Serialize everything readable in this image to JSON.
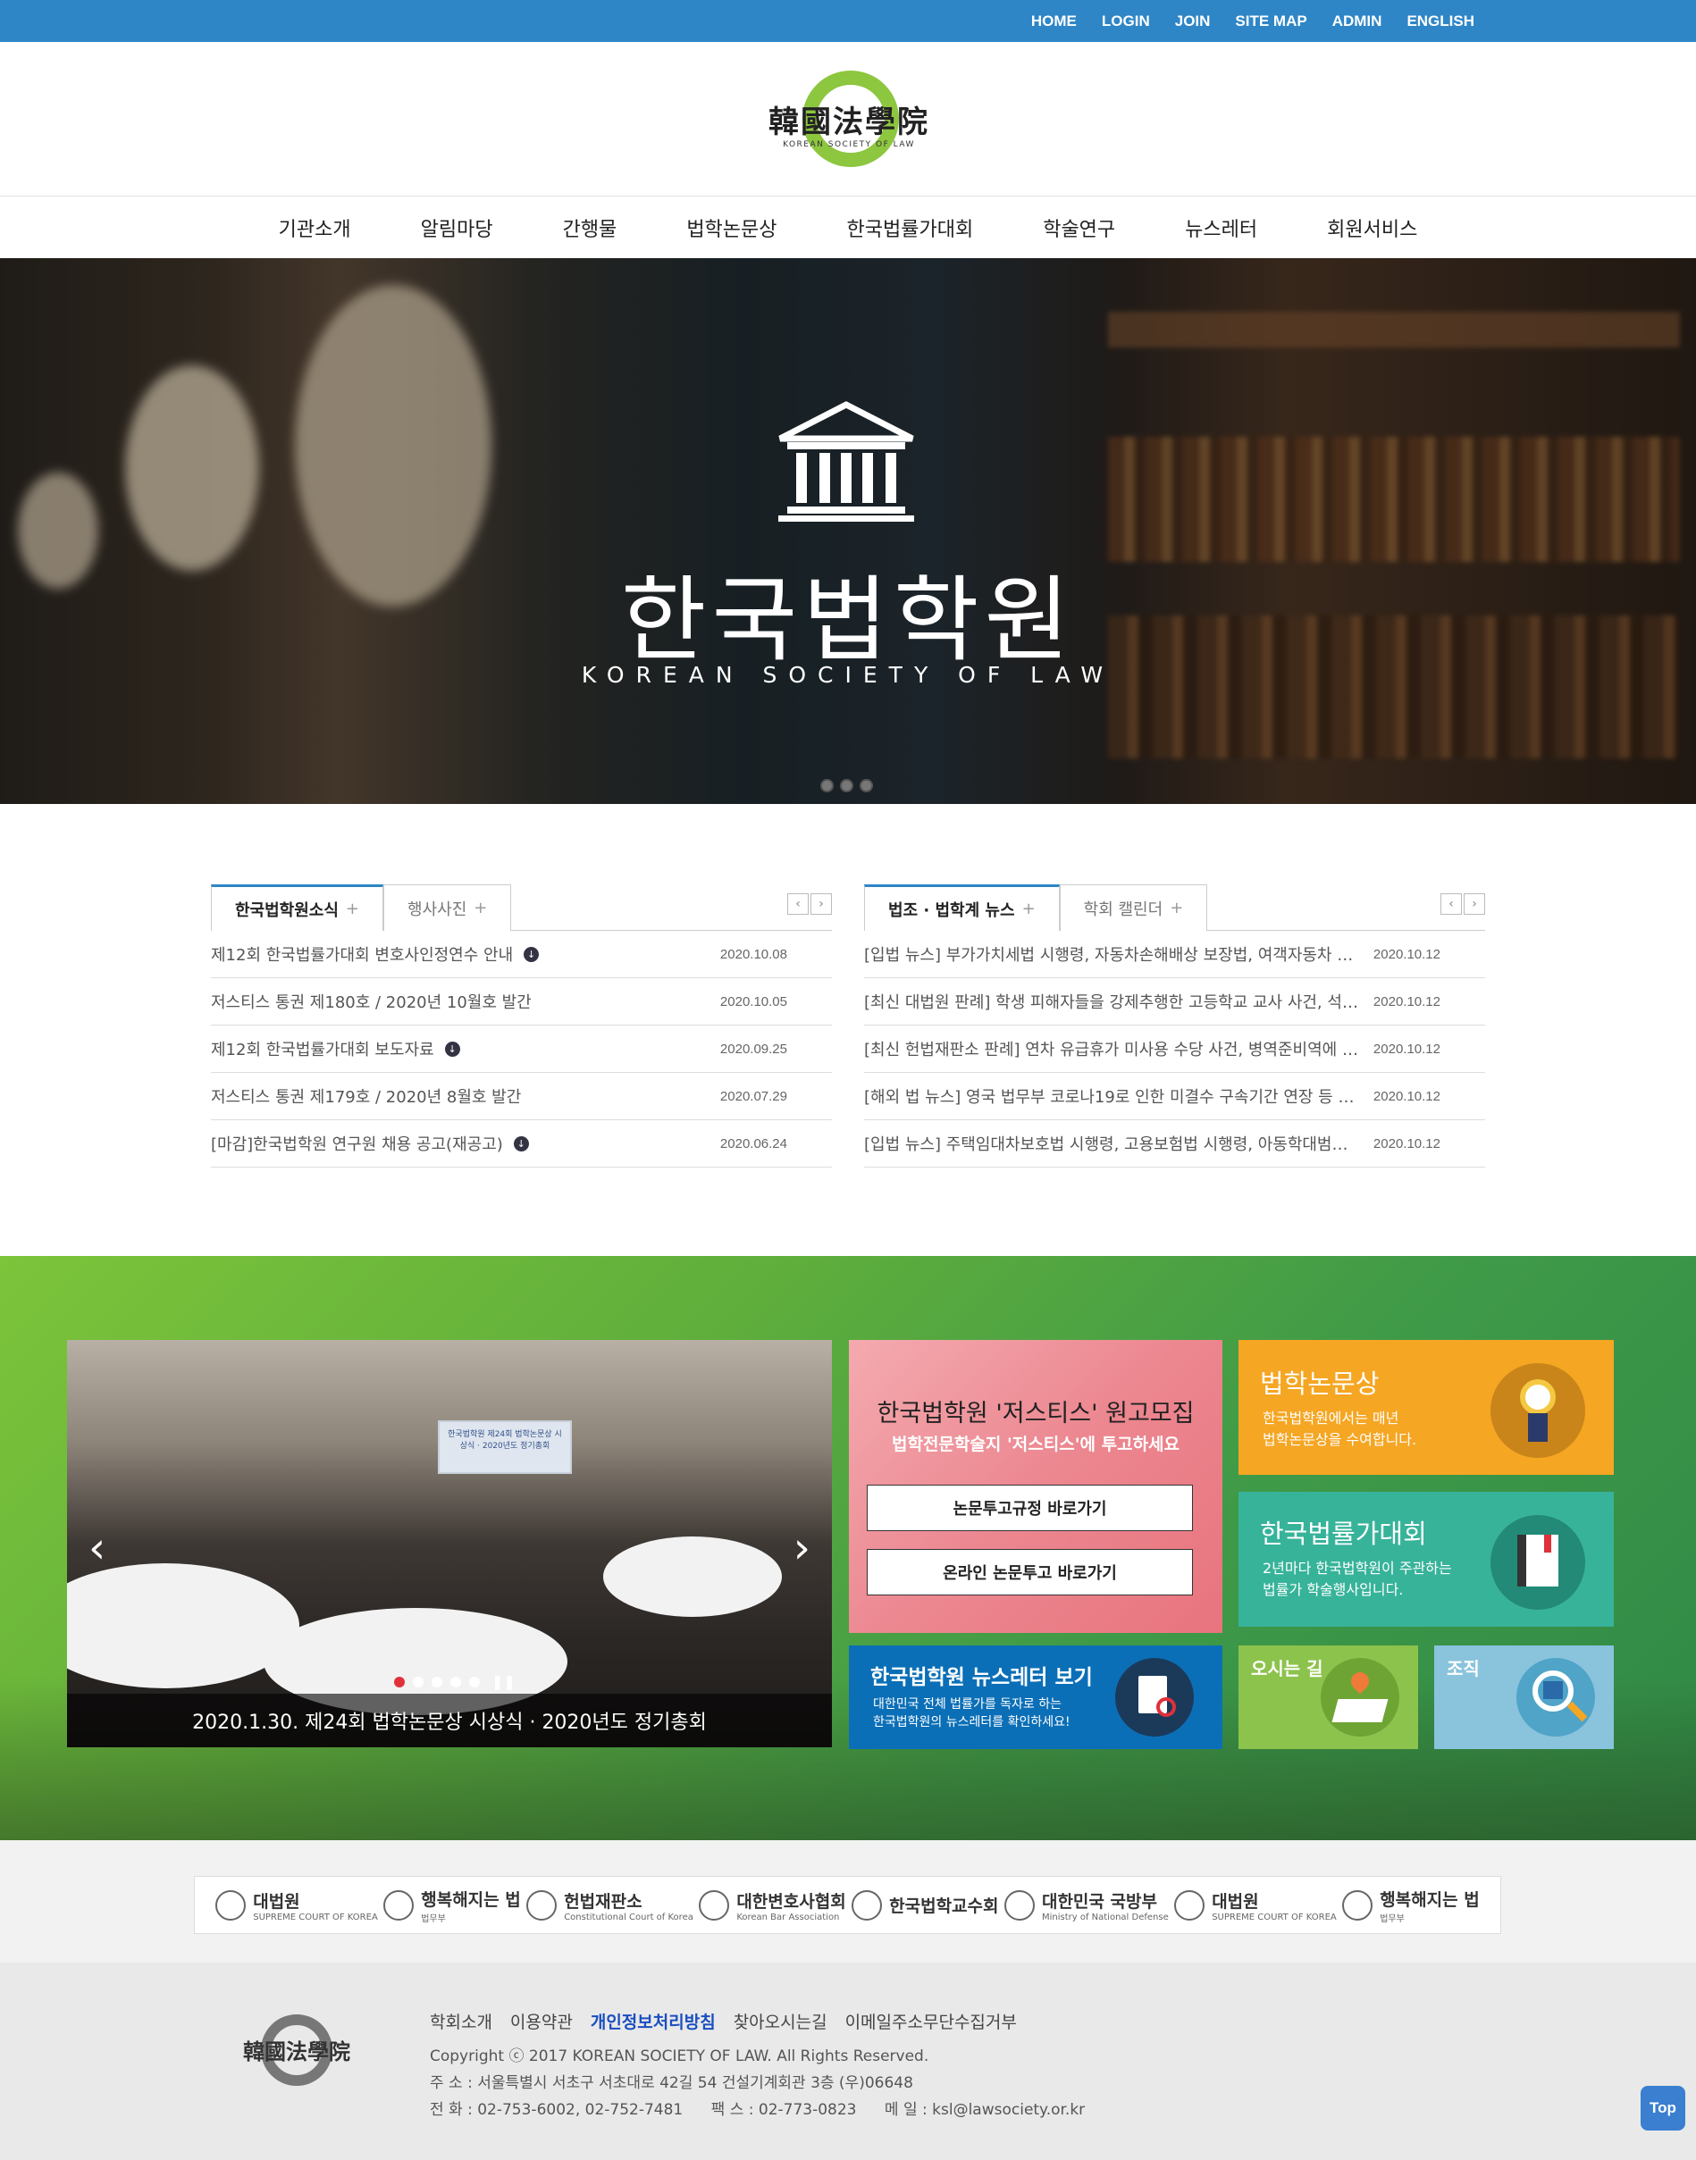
{
  "topbar": {
    "links": [
      "HOME",
      "LOGIN",
      "JOIN",
      "SITE MAP",
      "ADMIN",
      "ENGLISH"
    ],
    "bg": "#2e86c7"
  },
  "logo": {
    "hanja": "韓國法學院",
    "english": "KOREAN SOCIETY OF LAW"
  },
  "gnb": {
    "items": [
      "기관소개",
      "알림마당",
      "간행물",
      "법학논문상",
      "한국법률가대회",
      "학술연구",
      "뉴스레터",
      "회원서비스"
    ]
  },
  "hero": {
    "title": "한국법학원",
    "subtitle": "KOREAN SOCIETY OF LAW",
    "icon": "temple-icon",
    "slide_count": 3
  },
  "board_left": {
    "tabs": [
      "한국법학원소식",
      "행사사진"
    ],
    "rows": [
      {
        "title": "제12회 한국법률가대회 변호사인정연수 안내",
        "date": "2020.10.08",
        "download": true
      },
      {
        "title": "저스티스 통권 제180호 / 2020년 10월호 발간",
        "date": "2020.10.05",
        "download": false
      },
      {
        "title": "제12회 한국법률가대회 보도자료",
        "date": "2020.09.25",
        "download": true
      },
      {
        "title": "저스티스 통권 제179호 / 2020년 8월호 발간",
        "date": "2020.07.29",
        "download": false
      },
      {
        "title": "[마감]한국법학원 연구원 채용 공고(재공고)",
        "date": "2020.06.24",
        "download": true
      }
    ]
  },
  "board_right": {
    "tabs": [
      "법조 · 법학계 뉴스",
      "학회 캘린더"
    ],
    "rows": [
      {
        "title": "[입법 뉴스] 부가가치세법 시행령, 자동차손해배상 보장법, 여객자동차 …",
        "date": "2020.10.12"
      },
      {
        "title": "[최신 대법원 판례] 학생 피해자들을 강제추행한 고등학교 교사 사건, 석…",
        "date": "2020.10.12"
      },
      {
        "title": "[최신 헌법재판소 판례] 연차 유급휴가 미사용 수당 사건, 병역준비역에 …",
        "date": "2020.10.12"
      },
      {
        "title": "[해외 법 뉴스] 영국 법무부 코로나19로 인한 미결수 구속기간 연장 등 …",
        "date": "2020.10.12"
      },
      {
        "title": "[입법 뉴스] 주택임대차보호법 시행령, 고용보험법 시행령, 아동학대범…",
        "date": "2020.10.12"
      }
    ]
  },
  "promo": {
    "photo_caption": "2020.1.30. 제24회 법학논문상 시상식 · 2020년도 정기총회",
    "photo_screen_text": "한국법학원 제24회 법학논문상 시상식 · 2020년도 정기총회",
    "recruit": {
      "title": "한국법학원 '저스티스' 원고모집",
      "subtitle": "법학전문학술지 '저스티스'에 투고하세요",
      "btn1": "논문투고규정 바로가기",
      "btn2": "온라인 논문투고 바로가기"
    },
    "newsletter": {
      "title": "한국법학원 뉴스레터 보기",
      "desc1": "대한민국 전체 법률가를 독자로 하는",
      "desc2": "한국법학원의 뉴스레터를 확인하세요!",
      "icon": "newsletter-icon"
    },
    "prize": {
      "title": "법학논문상",
      "desc1": "한국법학원에서는 매년",
      "desc2": "법학논문상을 수여합니다.",
      "icon": "medal-icon"
    },
    "conference": {
      "title": "한국법률가대회",
      "desc1": "2년마다 한국법학원이 주관하는",
      "desc2": "법률가 학술행사입니다.",
      "icon": "book-icon"
    },
    "directions": {
      "title": "오시는 길",
      "icon": "map-pin-icon"
    },
    "organization": {
      "title": "조직",
      "icon": "house-search-icon"
    }
  },
  "partners": [
    {
      "name": "대법원",
      "sub": "SUPREME COURT OF KOREA"
    },
    {
      "name": "행복해지는 법",
      "sub": "법무부"
    },
    {
      "name": "헌법재판소",
      "sub": "Constitutional Court of Korea"
    },
    {
      "name": "대한변호사협회",
      "sub": "Korean Bar Association"
    },
    {
      "name": "한국법학교수회",
      "sub": ""
    },
    {
      "name": "대한민국 국방부",
      "sub": "Ministry of National Defense"
    },
    {
      "name": "대법원",
      "sub": "SUPREME COURT OF KOREA"
    },
    {
      "name": "행복해지는 법",
      "sub": "법무부"
    }
  ],
  "footer": {
    "links": [
      "학회소개",
      "이용약관",
      "개인정보처리방침",
      "찾아오시는길",
      "이메일주소무단수집거부"
    ],
    "copyright": "Copyright ⓒ 2017 KOREAN SOCIETY OF LAW. All Rights Reserved.",
    "address": "주 소 : 서울특별시 서초구 서초대로 42길 54 건설기계회관 3층 (우)06648",
    "phone": "전 화 : 02-753-6002, 02-752-7481",
    "fax": "팩 스 : 02-773-0823",
    "email": "메 일 : ksl@lawsociety.or.kr",
    "logo_hanja": "韓國法學院",
    "top_label": "Top"
  }
}
